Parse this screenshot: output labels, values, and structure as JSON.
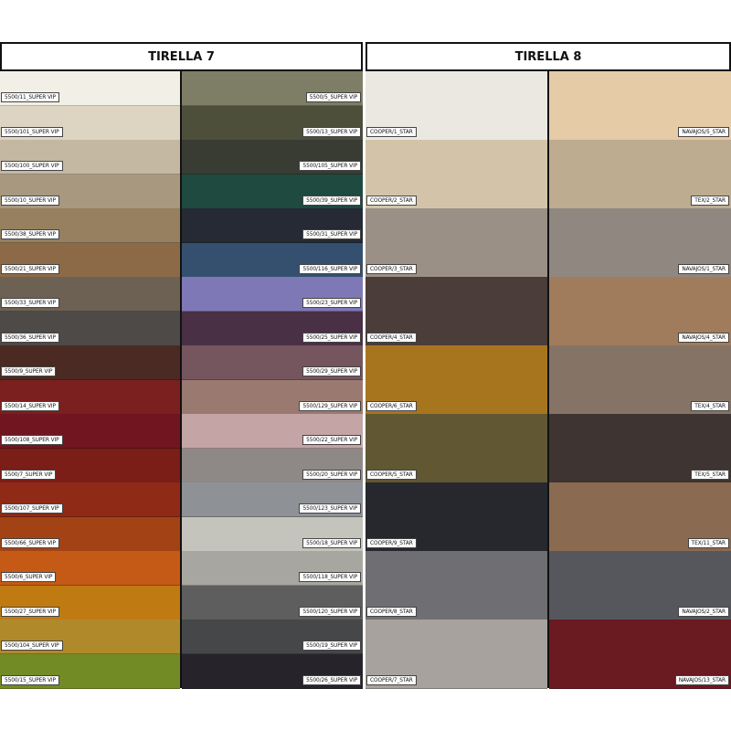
{
  "panels": [
    {
      "title": "TIRELLA 7",
      "columns": [
        [
          {
            "label": "5500/11_SUPER VIP",
            "color": "#f2efe6"
          },
          {
            "label": "5500/101_SUPER VIP",
            "color": "#ddd5c2"
          },
          {
            "label": "5500/100_SUPER VIP",
            "color": "#c4b8a2"
          },
          {
            "label": "5500/10_SUPER VIP",
            "color": "#a89880"
          },
          {
            "label": "5500/38_SUPER VIP",
            "color": "#96805f"
          },
          {
            "label": "5500/21_SUPER VIP",
            "color": "#8c6a47"
          },
          {
            "label": "5500/33_SUPER VIP",
            "color": "#6d6154"
          },
          {
            "label": "5500/36_SUPER VIP",
            "color": "#4e4a47"
          },
          {
            "label": "5500/9_SUPER VIP",
            "color": "#4a2a22"
          },
          {
            "label": "5500/14_SUPER VIP",
            "color": "#7c1f1f"
          },
          {
            "label": "5500/108_SUPER VIP",
            "color": "#711621"
          },
          {
            "label": "5500/7_SUPER VIP",
            "color": "#7a1e17"
          },
          {
            "label": "5500/107_SUPER VIP",
            "color": "#8e2a15"
          },
          {
            "label": "5500/66_SUPER VIP",
            "color": "#a34315"
          },
          {
            "label": "5500/6_SUPER VIP",
            "color": "#c45a15"
          },
          {
            "label": "5500/27_SUPER VIP",
            "color": "#c07a12"
          },
          {
            "label": "5500/104_SUPER VIP",
            "color": "#b08a2a"
          },
          {
            "label": "5500/15_SUPER VIP",
            "color": "#728b25"
          }
        ],
        [
          {
            "label": "5500/5_SUPER VIP",
            "color": "#7e7d66"
          },
          {
            "label": "5500/13_SUPER VIP",
            "color": "#4d4f3b"
          },
          {
            "label": "5500/105_SUPER VIP",
            "color": "#383c33"
          },
          {
            "label": "5500/39_SUPER VIP",
            "color": "#1e4a3f"
          },
          {
            "label": "5500/31_SUPER VIP",
            "color": "#252a34"
          },
          {
            "label": "5500/116_SUPER VIP",
            "color": "#34506e"
          },
          {
            "label": "5500/23_SUPER VIP",
            "color": "#7f78b6"
          },
          {
            "label": "5500/25_SUPER VIP",
            "color": "#4a3044"
          },
          {
            "label": "5500/29_SUPER VIP",
            "color": "#75555e"
          },
          {
            "label": "5500/129_SUPER VIP",
            "color": "#9a7a70"
          },
          {
            "label": "5500/22_SUPER VIP",
            "color": "#c4a4a4"
          },
          {
            "label": "5500/20_SUPER VIP",
            "color": "#8e8886"
          },
          {
            "label": "5500/123_SUPER VIP",
            "color": "#8e9296"
          },
          {
            "label": "5500/18_SUPER VIP",
            "color": "#c4c4bc"
          },
          {
            "label": "5500/118_SUPER VIP",
            "color": "#a8a6a0"
          },
          {
            "label": "5500/120_SUPER VIP",
            "color": "#5e5e5e"
          },
          {
            "label": "5500/19_SUPER VIP",
            "color": "#464748"
          },
          {
            "label": "5500/26_SUPER VIP",
            "color": "#26232a"
          }
        ]
      ]
    },
    {
      "title": "TIRELLA 8",
      "columns": [
        [
          {
            "label": "COOPER/1_STAR",
            "color": "#ebe8e2"
          },
          {
            "label": "COOPER/2_STAR",
            "color": "#d3c4a9"
          },
          {
            "label": "COOPER/3_STAR",
            "color": "#9b9086"
          },
          {
            "label": "COOPER/4_STAR",
            "color": "#4b3d39"
          },
          {
            "label": "COOPER/6_STAR",
            "color": "#a8751f"
          },
          {
            "label": "COOPER/5_STAR",
            "color": "#615733"
          },
          {
            "label": "COOPER/9_STAR",
            "color": "#26282e"
          },
          {
            "label": "COOPER/8_STAR",
            "color": "#6f6f73"
          },
          {
            "label": "COOPER/7_STAR",
            "color": "#a7a29d"
          }
        ],
        [
          {
            "label": "NAVAJOS/5_STAR",
            "color": "#e5cba6"
          },
          {
            "label": "TEX/2_STAR",
            "color": "#bdac90"
          },
          {
            "label": "NAVAJOS/1_STAR",
            "color": "#8f8780"
          },
          {
            "label": "NAVAJOS/4_STAR",
            "color": "#a17c5c"
          },
          {
            "label": "TEX/4_STAR",
            "color": "#857466"
          },
          {
            "label": "TEX/5_STAR",
            "color": "#3e3432"
          },
          {
            "label": "TEX/11_STAR",
            "color": "#8a6a50"
          },
          {
            "label": "NAVAJOS/2_STAR",
            "color": "#56575c"
          },
          {
            "label": "NAVAJOS/13_STAR",
            "color": "#6a1a21"
          }
        ]
      ]
    }
  ]
}
